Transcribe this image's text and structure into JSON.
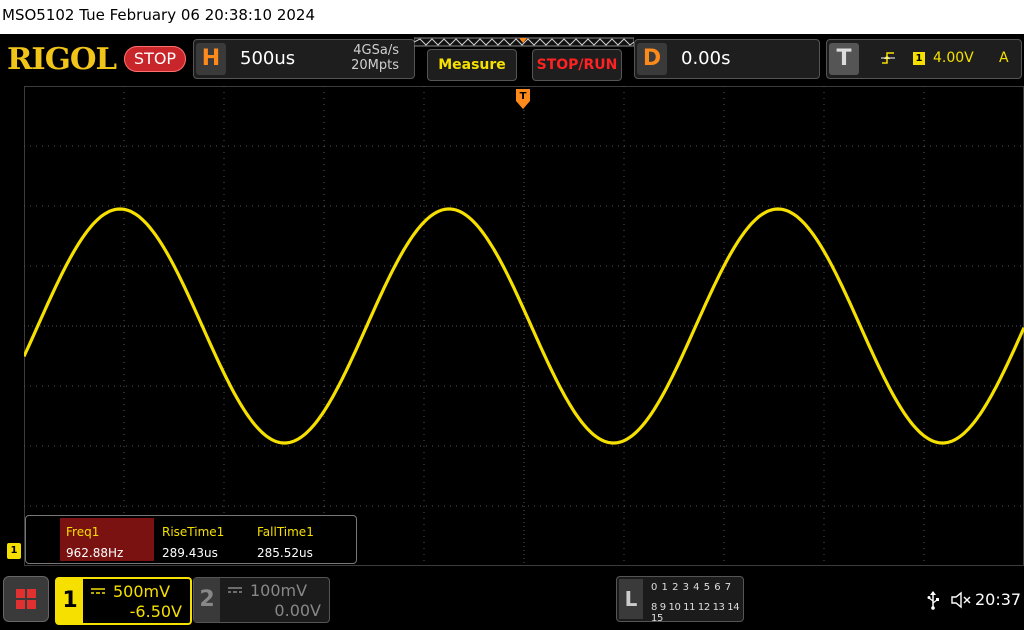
{
  "titlebar": {
    "text": "MSO5102  Tue February 06 20:38:10 2024"
  },
  "header": {
    "brand": "RIGOL",
    "run_state": "STOP",
    "horizontal": {
      "tag": "H",
      "timebase": "500us",
      "sample_rate": "4GSa/s",
      "memory_depth": "20Mpts"
    },
    "measure_label": "Measure",
    "stoprun_label": "STOP/RUN",
    "delay": {
      "tag": "D",
      "value": "0.00s"
    },
    "trigger": {
      "tag": "T",
      "source": "1",
      "level": "4.00V",
      "mode": "A",
      "edge_icon": "rising-edge-icon"
    }
  },
  "screen": {
    "trigger_marker": "T",
    "ch1_marker": "1",
    "trace_color": "#f5e000",
    "grid": {
      "divisions_x": 10,
      "divisions_y": 8
    }
  },
  "measurements": [
    {
      "label": "Freq1",
      "value": "962.88Hz",
      "selected": true
    },
    {
      "label": "RiseTime1",
      "value": "289.43us",
      "selected": false
    },
    {
      "label": "FallTime1",
      "value": "285.52us",
      "selected": false
    }
  ],
  "channels": {
    "ch1": {
      "num": "1",
      "scale": "500mV",
      "offset": "-6.50V",
      "color": "#f5e000"
    },
    "ch2": {
      "num": "2",
      "scale": "100mV",
      "offset": "0.00V",
      "color": "#888888"
    }
  },
  "logic": {
    "tag": "L",
    "row1": "0 1 2 3   4 5 6 7",
    "row2": "8 9 10 11 12 13 14 15"
  },
  "status": {
    "time": "20:37",
    "usb_icon": "usb-icon",
    "sound_icon": "speaker-muted-icon"
  },
  "chart_data": {
    "type": "line",
    "title": "",
    "xlabel": "",
    "ylabel": "",
    "xlim": [
      -2.5,
      2.5
    ],
    "ylim": [
      -4,
      4
    ],
    "series": [
      {
        "points": [
          [
            -2.5,
            -0.8
          ],
          [
            -2.25,
            1.3
          ],
          [
            -2.02,
            1.95
          ],
          [
            -1.8,
            1.3
          ],
          [
            -1.5,
            -1.0
          ],
          [
            -1.21,
            -1.95
          ],
          [
            -0.95,
            -0.9
          ],
          [
            -0.7,
            1.25
          ],
          [
            -0.45,
            1.95
          ],
          [
            -0.2,
            1.25
          ],
          [
            0.0,
            0.0
          ],
          [
            0.22,
            -1.3
          ],
          [
            0.48,
            -1.95
          ],
          [
            0.75,
            -0.9
          ],
          [
            1.0,
            1.0
          ],
          [
            1.27,
            1.95
          ],
          [
            1.55,
            1.0
          ],
          [
            1.8,
            -1.0
          ],
          [
            2.01,
            -1.95
          ],
          [
            2.25,
            -1.0
          ],
          [
            2.5,
            1.15
          ]
        ]
      }
    ],
    "grid": true
  }
}
